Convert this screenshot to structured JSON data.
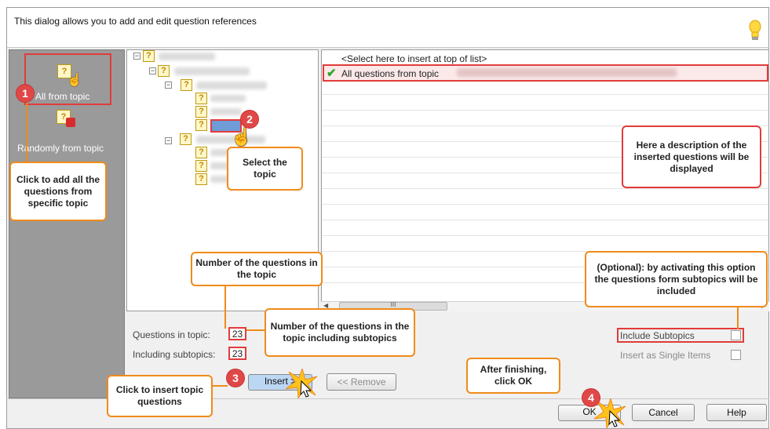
{
  "header": {
    "description": "This dialog allows you to add and edit question references",
    "hint_icon": "lightbulb-icon"
  },
  "left_pane": {
    "items": [
      {
        "label": "All from topic",
        "icon": "topic-question-icon"
      },
      {
        "label": "Randomly from topic",
        "icon": "random-dice-icon"
      }
    ]
  },
  "list": {
    "insert_top": "<Select here to insert at top of list>",
    "rows": [
      {
        "label": "All questions from topic",
        "check_icon": "checkmark-icon"
      }
    ],
    "scroll_thumb": "III"
  },
  "counts": {
    "questions_in_topic_label": "Questions in topic:",
    "questions_in_topic_value": "23",
    "including_subtopics_label": "Including subtopics:",
    "including_subtopics_value": "23"
  },
  "options": {
    "include_subtopics": "Include Subtopics",
    "insert_single": "Insert as Single Items"
  },
  "buttons": {
    "insert": "Insert >",
    "remove": "<< Remove",
    "ok": "OK",
    "cancel": "Cancel",
    "help": "Help"
  },
  "callouts": {
    "c1": "Click to add all the questions from specific topic",
    "c2": "Select the topic",
    "c3": "Here a description of the inserted questions will be displayed",
    "c4": "Number of the questions in the topic",
    "c5": "Number of the questions in the topic including subtopics",
    "c6": "(Optional): by activating this option the questions form subtopics will be included",
    "c7": "Click to insert topic questions",
    "c8": "After finishing, click OK"
  },
  "badges": [
    "1",
    "2",
    "3",
    "4"
  ],
  "colors": {
    "callout_border": "#f08b1a",
    "highlight": "#e23b3b",
    "badge": "#e04848",
    "left_pane": "#9a9a9a"
  }
}
